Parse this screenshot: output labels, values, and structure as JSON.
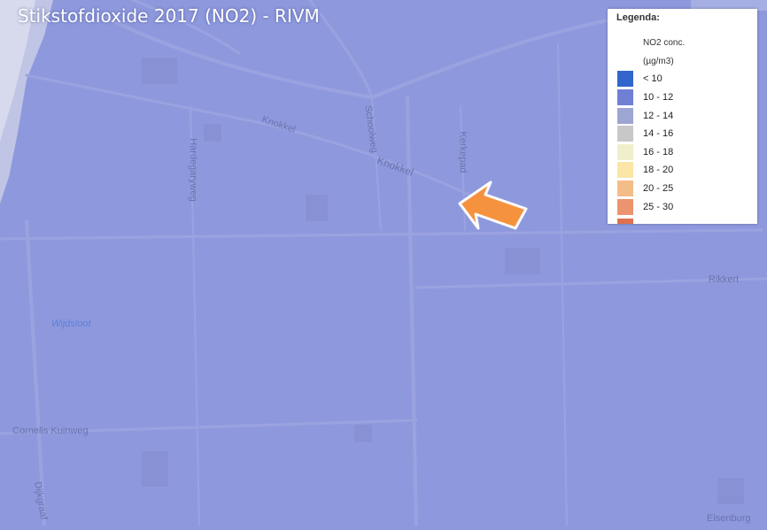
{
  "map": {
    "title": "Stikstofdioxide 2017 (NO2) - RIVM",
    "base_color": "#8e99dd",
    "streets": {
      "knokkel_1": "Knokkel",
      "knokkel_2": "Knokkel",
      "schoolweg": "Schoolweg",
      "kerkepad": "Kerkepad",
      "hardegarijpsweg": "Hardegaryweg",
      "rikkert": "Rikkert",
      "cornelis_kuinweg": "Cornelis Kuinweg",
      "dijkgraaf": "Dijkgraaf",
      "elsenburg": "Elsenburg",
      "wijdsloot": "Wijdsloot"
    },
    "arrow_color": "#f5923e"
  },
  "legend": {
    "title": "Legenda:",
    "header_line1": "NO2 conc.",
    "header_line2": "(µg/m3)",
    "items": [
      {
        "label": "< 10",
        "color": "#3366cc"
      },
      {
        "label": "10 - 12",
        "color": "#6f80d4"
      },
      {
        "label": "12 - 14",
        "color": "#9da5d3"
      },
      {
        "label": "14 - 16",
        "color": "#c8c8c8"
      },
      {
        "label": "16 - 18",
        "color": "#efefcc"
      },
      {
        "label": "18 - 20",
        "color": "#fbe5a7"
      },
      {
        "label": "20 - 25",
        "color": "#f3bd8a"
      },
      {
        "label": "25 - 30",
        "color": "#ec9470"
      }
    ]
  }
}
